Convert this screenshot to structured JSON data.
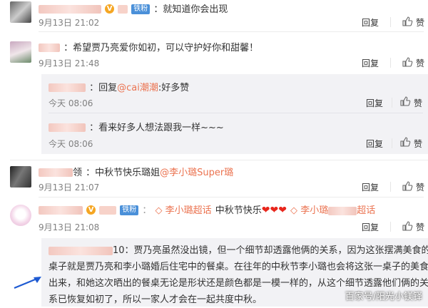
{
  "actions": {
    "reply": "回复",
    "like": "赞"
  },
  "comments": [
    {
      "username": "Super_",
      "text": "：就知道你会出现",
      "time": "9月13日 21:02",
      "badge": "铁粉"
    },
    {
      "text": "：希望贾乃亮爱你如初，可以守护好你和甜馨！",
      "time": "9月13日 21:48",
      "replies": [
        {
          "reply_prefix": "：回复",
          "mention": "@cai潮潮",
          "text": ":好多赞",
          "time": "今天 08:06"
        },
        {
          "text": "：看来好多人想法跟我一样~~~",
          "time": "今天 08:06"
        }
      ]
    },
    {
      "username_suffix": "领",
      "text": "：中秋节快乐璐姐",
      "mention": "@李小璐Super璐",
      "time": "9月13日 21:07"
    },
    {
      "badge": "铁粉",
      "supertopic1": "李小璐超话",
      "text": "中秋节快乐",
      "supertopic2_a": "李小璐",
      "supertopic2_b": "超话",
      "time": "9月13日 21:08",
      "reply": {
        "name_suffix": "10",
        "lines": [
          "：贾乃亮虽然没出镜，但一个细节却透露他俩的关系，因为这张摆满美食的",
          "桌子就是贾乃亮和李小璐婚后住宅中的餐桌。在往年的中秋节李小璐也会将这张一桌子的美食晒",
          "出来，和她这次晒出的餐桌无论是形状还是颜色都是一模一样的，从这个细节透露他们俩的关",
          "系已恢复如初了，所以一家人才会在一起共度中秋。"
        ]
      }
    }
  ],
  "watermark": "百家号/阳光小镁铎",
  "colors": {
    "link": "#eb7350",
    "meta": "#808080",
    "nested_bg": "#f2f2f5",
    "arrow": "#1e5ad2"
  }
}
